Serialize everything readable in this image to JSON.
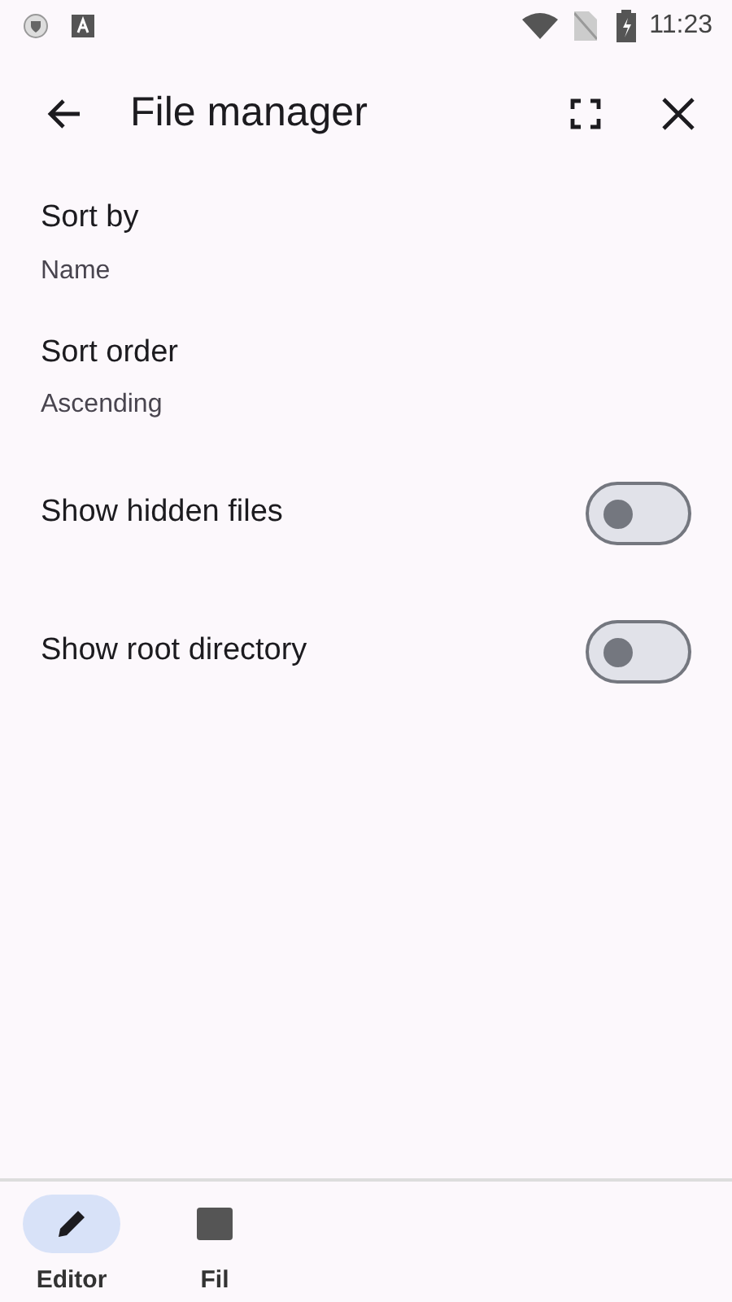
{
  "status_bar": {
    "time": "11:23"
  },
  "app_bar": {
    "title": "File manager"
  },
  "settings": [
    {
      "kind": "value",
      "label": "Sort by",
      "value": "Name"
    },
    {
      "kind": "value",
      "label": "Sort order",
      "value": "Ascending"
    },
    {
      "kind": "switch",
      "label": "Show hidden files",
      "on": false
    },
    {
      "kind": "switch",
      "label": "Show root directory",
      "on": false
    }
  ],
  "bottom_nav": [
    {
      "label": "Editor",
      "selected": true
    },
    {
      "label": "Fil",
      "selected": false
    }
  ]
}
